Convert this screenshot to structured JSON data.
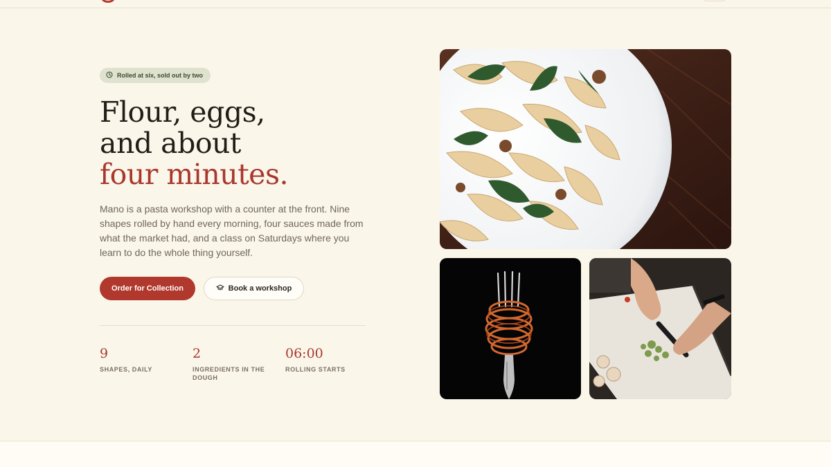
{
  "hero": {
    "badge": "Rolled at six, sold out by two",
    "headline_line1": "Flour, eggs,",
    "headline_line2": "and about",
    "headline_line3": "four minutes.",
    "intro": "Mano is a pasta workshop with a counter at the front. Nine shapes rolled by hand every morning, four sauces made from what the market had, and a class on Saturdays where you learn to do the whole thing yourself.",
    "primary_cta": "Order for Collection",
    "secondary_cta": "Book a workshop"
  },
  "stats": [
    {
      "value": "9",
      "label": "SHAPES, DAILY"
    },
    {
      "value": "2",
      "label": "INGREDIENTS IN THE DOUGH"
    },
    {
      "value": "06:00",
      "label": "ROLLING STARTS"
    }
  ],
  "icons": {
    "badge": "clock-icon",
    "secondary_cta": "graduation-cap-icon"
  },
  "colors": {
    "background": "#fbf6ea",
    "accent": "#b0382d",
    "badge_bg": "#dfe2cf",
    "text": "#231d18",
    "muted": "#6f655b"
  }
}
